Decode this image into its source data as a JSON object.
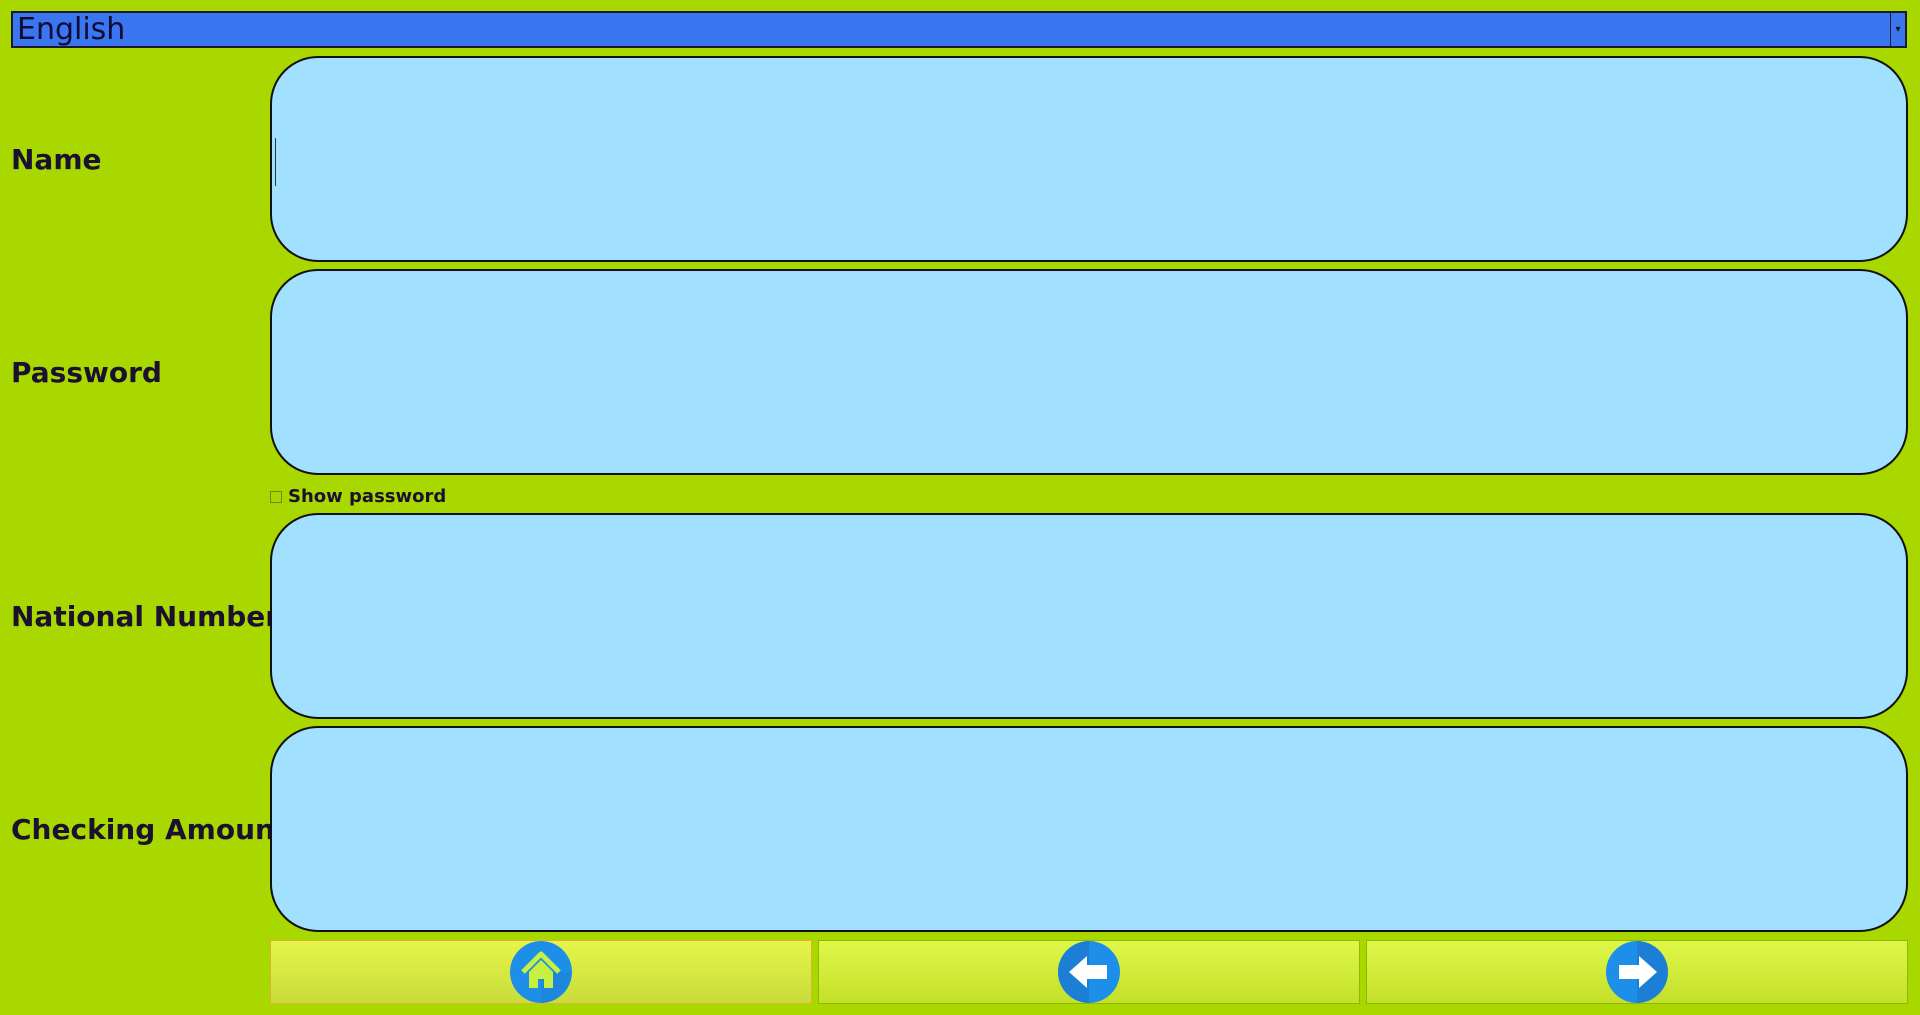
{
  "language": {
    "selected": "English"
  },
  "form": {
    "name_label": "Name",
    "name_value": "",
    "password_label": "Password",
    "password_value": "",
    "show_password_label": "Show password",
    "national_number_label": "National Number",
    "national_number_value": "",
    "checking_amount_label": "Checking Amount",
    "checking_amount_value": ""
  },
  "nav": {
    "home_icon": "home-icon",
    "back_icon": "arrow-left-icon",
    "next_icon": "arrow-right-icon"
  },
  "colors": {
    "background": "#a8d800",
    "input_fill": "#a1e0ff",
    "select_fill": "#3a76f0",
    "icon_blue": "#1e8fe8"
  }
}
